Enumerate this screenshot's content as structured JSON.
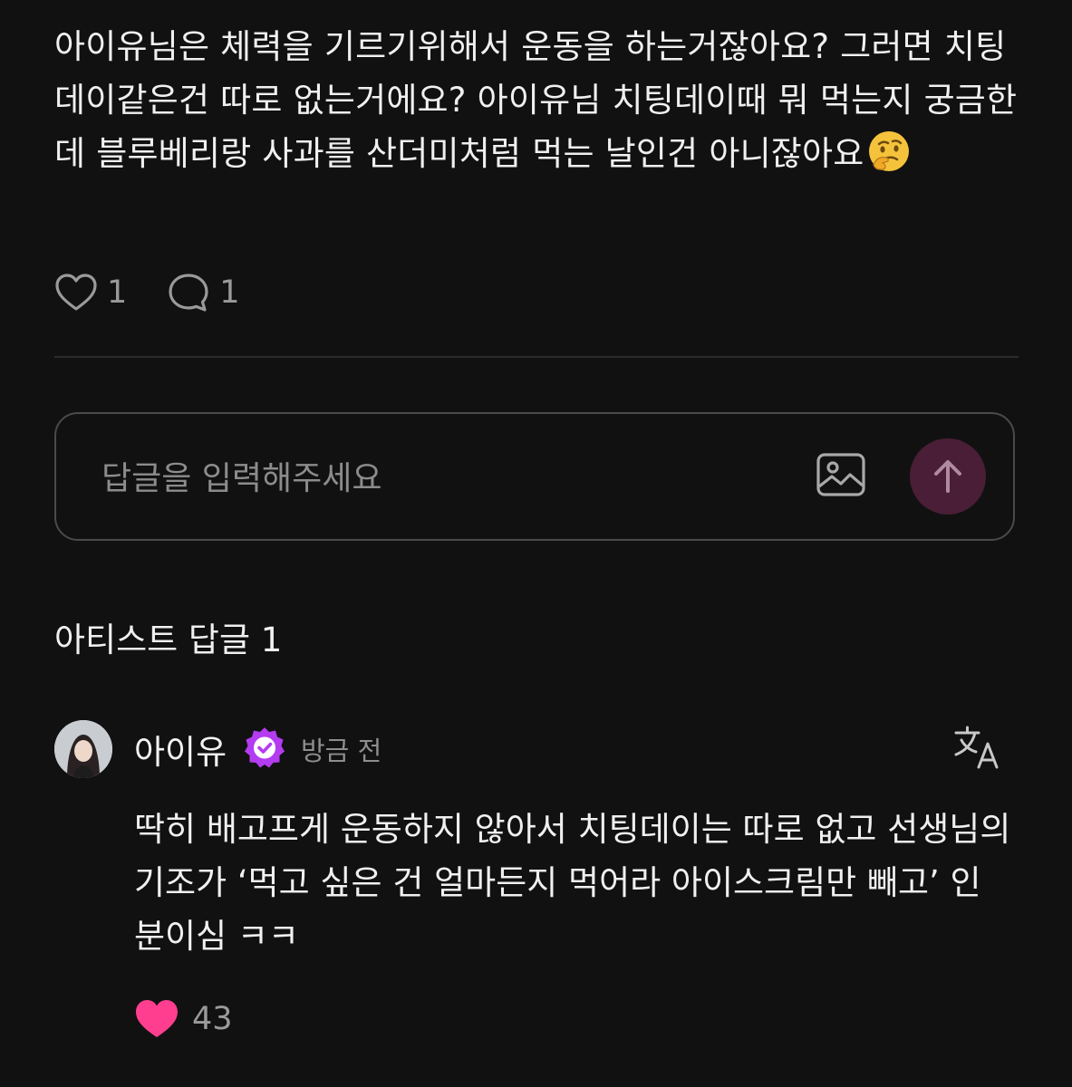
{
  "post": {
    "text": "아이유님은 체력을 기르기위해서 운동을 하는거잖아요? 그러면 치팅데이같은건 따로 없는거에요? 아이유님 치팅데이때 뭐 먹는지 궁금한데 블루베리랑 사과를 산더미처럼 먹는 날인건 아니잖아요",
    "emoji": "thinking-face-emoji",
    "like_count": "1",
    "comment_count": "1"
  },
  "reply_box": {
    "placeholder": "답글을 입력해주세요",
    "value": "",
    "image_icon": "image-icon",
    "send_icon": "arrow-up-icon"
  },
  "artist_replies": {
    "section_title": "아티스트 답글 1",
    "items": [
      {
        "author": "아이유",
        "verified": true,
        "timestamp": "방금 전",
        "text": "딱히 배고프게 운동하지 않아서 치팅데이는 따로 없고 선생님의 기조가 ‘먹고 싶은 건 얼마든지 먹어라 아이스크림만 빼고’ 인 분이심 ㅋㅋ",
        "like_count": "43",
        "liked": true
      }
    ]
  },
  "colors": {
    "background": "#111111",
    "accent_pink": "#ff3e8f",
    "verified_purple": "#b43cf0",
    "send_button": "#4a1e36"
  }
}
